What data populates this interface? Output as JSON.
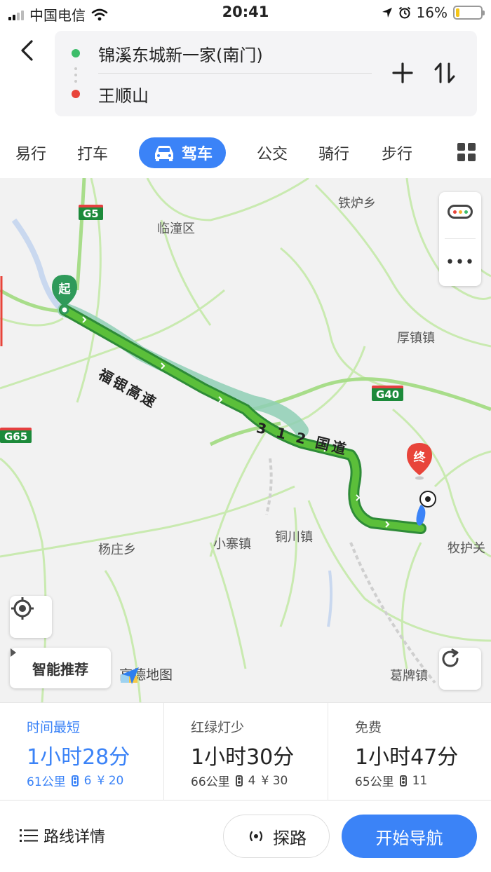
{
  "status_bar": {
    "carrier": "中国电信",
    "time": "20:41",
    "battery": "16%",
    "battery_level": 0.16
  },
  "route": {
    "start": "锦溪东城新一家(南门)",
    "end": "王顺山"
  },
  "tabs": [
    {
      "label": "易行"
    },
    {
      "label": "打车"
    },
    {
      "label": "驾车",
      "active": true
    },
    {
      "label": "公交"
    },
    {
      "label": "骑行"
    },
    {
      "label": "步行"
    }
  ],
  "map": {
    "place_labels": [
      "铁炉乡",
      "临潼区",
      "厚镇镇",
      "杨庄乡",
      "小寨镇",
      "铜川镇",
      "牧护关",
      "葛牌镇"
    ],
    "road_shields": [
      "G5",
      "G40",
      "G65",
      "G5"
    ],
    "route_labels": [
      "福银高速",
      "3 1 2 国道"
    ],
    "start_marker": "起",
    "end_marker": "终",
    "recommend_label": "智能推荐",
    "brand": "高德地图",
    "colors": {
      "route": "#3aa23f",
      "route_alt": "#8fcfb5",
      "start_marker": "#2f9a5a",
      "end_marker": "#e8443a",
      "road": "#c9eab0"
    }
  },
  "options": [
    {
      "label": "时间最短",
      "duration": "1小时28分",
      "distance": "61公里",
      "lights": "6",
      "toll": "¥ 20",
      "active": true
    },
    {
      "label": "红绿灯少",
      "duration": "1小时30分",
      "distance": "66公里",
      "lights": "4",
      "toll": "¥ 30"
    },
    {
      "label": "免费",
      "duration": "1小时47分",
      "distance": "65公里",
      "lights": "11"
    }
  ],
  "actions": {
    "detail": "路线详情",
    "explore": "探路",
    "navigate": "开始导航"
  },
  "colors": {
    "accent": "#3b83f7"
  }
}
